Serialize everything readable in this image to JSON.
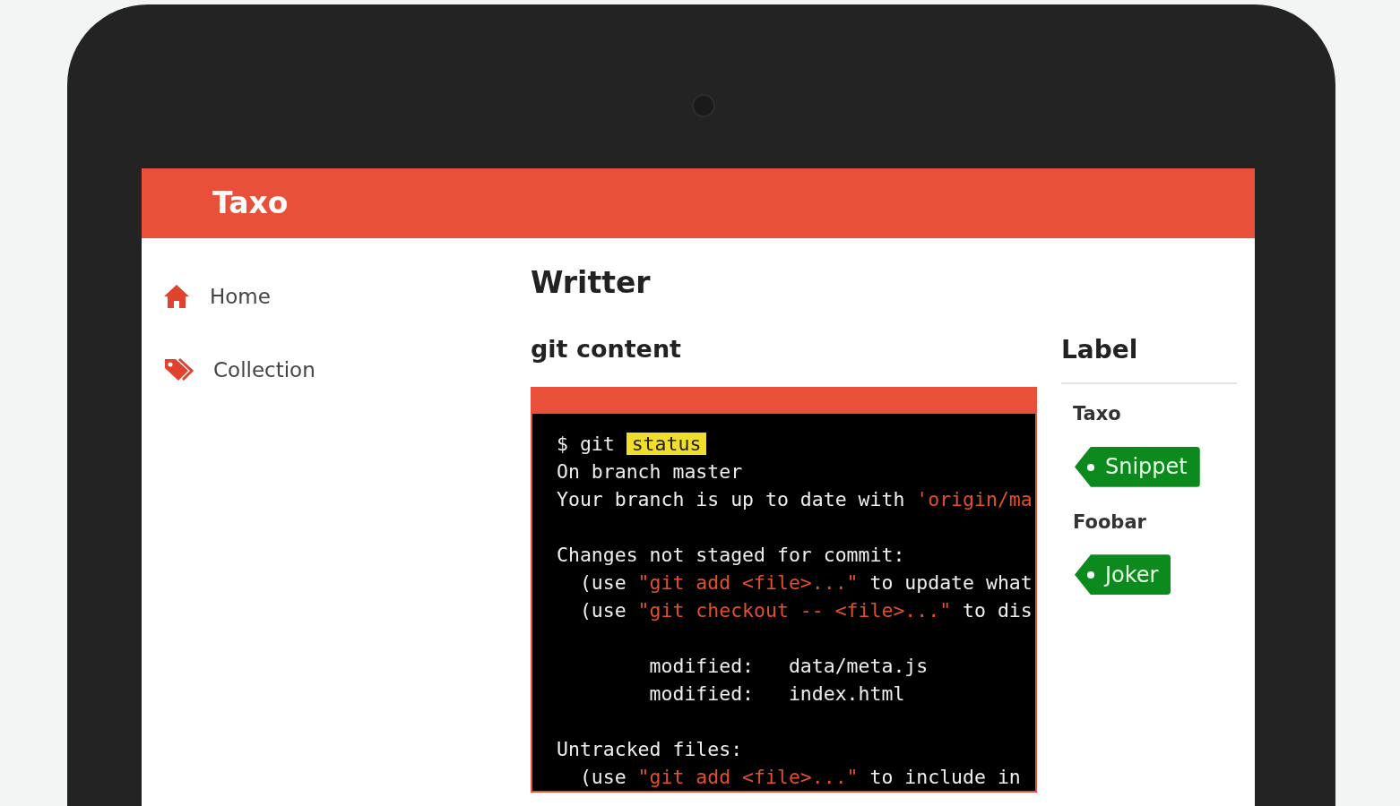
{
  "app": {
    "brand": "Taxo"
  },
  "sidebar": {
    "items": [
      {
        "label": "Home",
        "kind": "home"
      },
      {
        "label": "Collection",
        "kind": "tags"
      }
    ]
  },
  "main": {
    "title": "Writter",
    "subtitle": "git content",
    "terminal": {
      "blocks": [
        [
          [
            {
              "text": "$ git ",
              "kind": "plain"
            },
            {
              "text": "status",
              "kind": "highlight"
            }
          ],
          [
            {
              "text": "On branch master",
              "kind": "plain"
            }
          ],
          [
            {
              "text": "Your branch is up to date with ",
              "kind": "plain"
            },
            {
              "text": "'origin/ma",
              "kind": "string"
            }
          ]
        ],
        [
          [
            {
              "text": "Changes not staged for commit:",
              "kind": "plain"
            }
          ],
          [
            {
              "text": "  (use ",
              "kind": "plain"
            },
            {
              "text": "\"git add <file>...\"",
              "kind": "string"
            },
            {
              "text": " to update what",
              "kind": "plain"
            }
          ],
          [
            {
              "text": "  (use ",
              "kind": "plain"
            },
            {
              "text": "\"git checkout -- <file>...\"",
              "kind": "string"
            },
            {
              "text": " to dis",
              "kind": "plain"
            }
          ]
        ],
        [
          [
            {
              "text": "        modified:   data/meta.js",
              "kind": "plain"
            }
          ],
          [
            {
              "text": "        modified:   index.html",
              "kind": "plain"
            }
          ]
        ],
        [
          [
            {
              "text": "Untracked files:",
              "kind": "plain"
            }
          ],
          [
            {
              "text": "  (use ",
              "kind": "plain"
            },
            {
              "text": "\"git add <file>...\"",
              "kind": "string"
            },
            {
              "text": " to include in",
              "kind": "plain"
            }
          ]
        ]
      ]
    }
  },
  "labels": {
    "title": "Label",
    "groups": [
      {
        "name": "Taxo",
        "tags": [
          "Snippet"
        ]
      },
      {
        "name": "Foobar",
        "tags": [
          "Joker"
        ]
      }
    ]
  }
}
